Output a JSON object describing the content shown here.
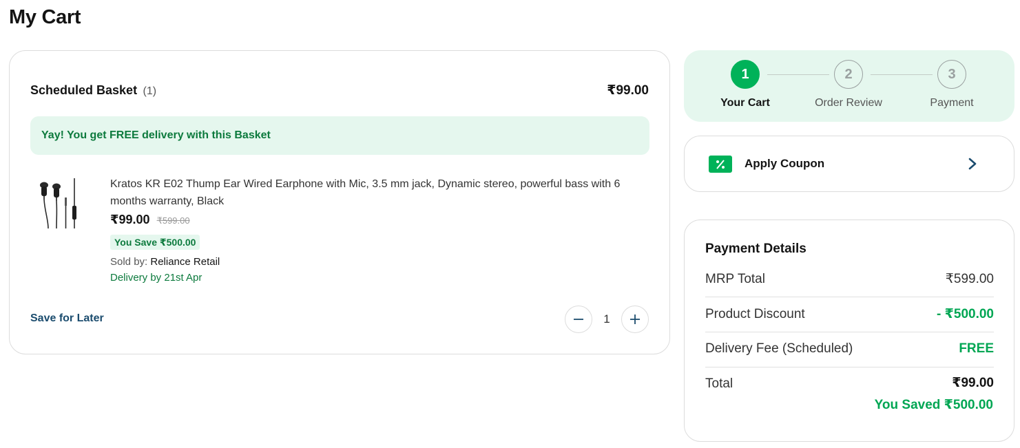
{
  "page": {
    "title": "My Cart"
  },
  "basket": {
    "title": "Scheduled Basket",
    "count": "(1)",
    "total": "₹99.00",
    "free_delivery_text": "Yay! You get FREE delivery with this Basket"
  },
  "product": {
    "name": "Kratos KR E02 Thump Ear Wired Earphone with Mic, 3.5 mm jack, Dynamic stereo, powerful bass with 6 months warranty, Black",
    "price": "₹99.00",
    "mrp": "₹599.00",
    "savings": "You Save ₹500.00",
    "sold_by_label": "Sold by:",
    "seller": "Reliance Retail",
    "delivery": "Delivery by 21st Apr",
    "image_icon": "earphones-image"
  },
  "actions": {
    "save_for_later": "Save for Later",
    "quantity": "1"
  },
  "stepper": {
    "steps": [
      {
        "number": "1",
        "label": "Your Cart",
        "active": true
      },
      {
        "number": "2",
        "label": "Order Review",
        "active": false
      },
      {
        "number": "3",
        "label": "Payment",
        "active": false
      }
    ]
  },
  "coupon": {
    "label": "Apply Coupon",
    "icon": "discount-tag-icon"
  },
  "payment": {
    "title": "Payment Details",
    "rows": [
      {
        "label": "MRP Total",
        "value": "₹599.00"
      },
      {
        "label": "Product Discount",
        "value": "- ₹500.00"
      },
      {
        "label": "Delivery Fee (Scheduled)",
        "value": "FREE"
      },
      {
        "label": "Total",
        "value": "₹99.00"
      }
    ],
    "saved": "You Saved ₹500.00"
  },
  "colors": {
    "accent_green": "#00b259",
    "light_green_bg": "#e5f7ee",
    "dark_green_text": "#0c7a3d",
    "link_blue": "#1b4c6e"
  }
}
